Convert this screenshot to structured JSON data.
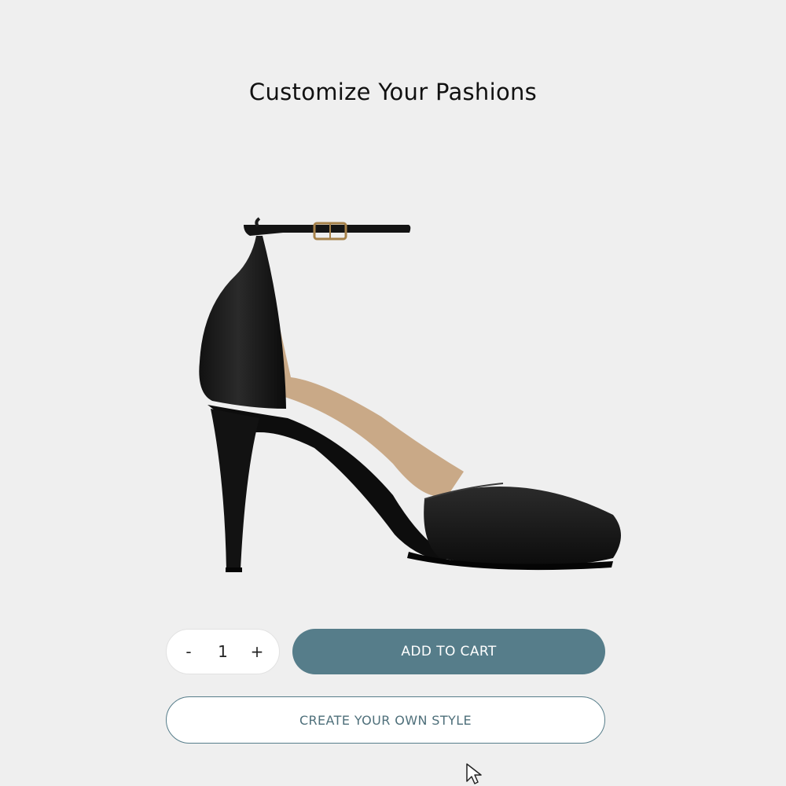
{
  "header": {
    "title": "Customize Your Pashions"
  },
  "product": {
    "image_icon": "high-heel-shoe-image"
  },
  "quantity": {
    "decrement_label": "-",
    "value": "1",
    "increment_label": "+"
  },
  "actions": {
    "add_to_cart_label": "ADD TO CART",
    "create_style_label": "CREATE YOUR OWN STYLE"
  },
  "colors": {
    "background": "#efefef",
    "accent": "#567d8a",
    "button_text": "#ffffff"
  },
  "cursor": {
    "icon": "mouse-pointer-icon"
  }
}
